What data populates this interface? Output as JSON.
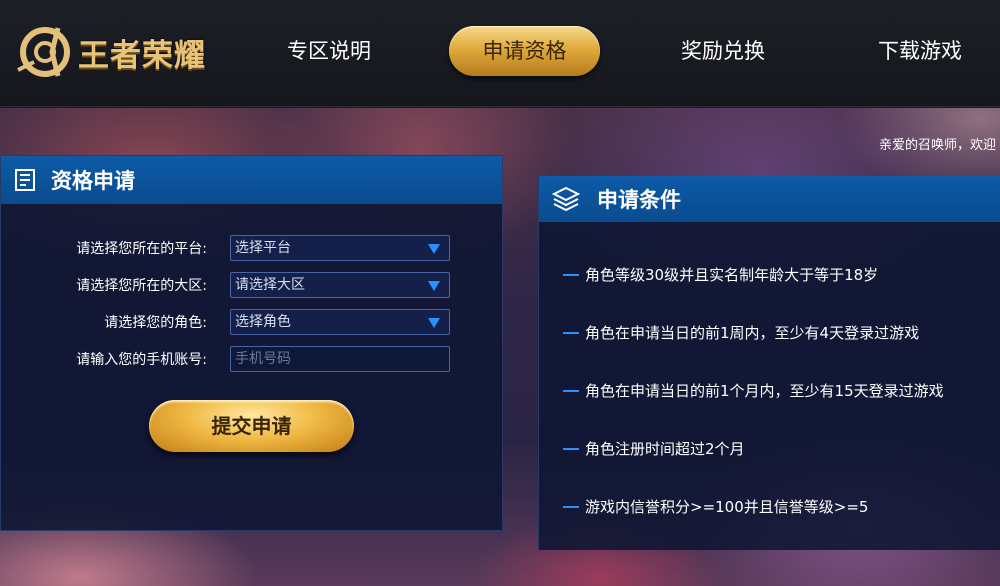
{
  "header": {
    "logo_text": "王者荣耀",
    "nav": [
      {
        "label": "专区说明",
        "active": false
      },
      {
        "label": "申请资格",
        "active": true
      },
      {
        "label": "奖励兑换",
        "active": false
      },
      {
        "label": "下载游戏",
        "active": false
      }
    ]
  },
  "welcome_text": "亲爱的召唤师，欢迎",
  "apply_panel": {
    "title": "资格申请",
    "fields": [
      {
        "label": "请选择您所在的平台:",
        "value": "选择平台",
        "type": "select"
      },
      {
        "label": "请选择您所在的大区:",
        "value": "请选择大区",
        "type": "select"
      },
      {
        "label": "请选择您的角色:",
        "value": "选择角色",
        "type": "select"
      },
      {
        "label": "请输入您的手机账号:",
        "placeholder": "手机号码",
        "type": "input"
      }
    ],
    "submit_label": "提交申请"
  },
  "conditions_panel": {
    "title": "申请条件",
    "items": [
      "角色等级30级并且实名制年龄大于等于18岁",
      "角色在申请当日的前1周内，至少有4天登录过游戏",
      "角色在申请当日的前1个月内，至少有15天登录过游戏",
      "角色注册时间超过2个月",
      "游戏内信誉积分>=100并且信誉等级>=5"
    ]
  },
  "colors": {
    "accent_gold": "#e0aa3c",
    "panel_header_blue": "#0d5aa6",
    "bullet_blue": "#2a8fff"
  }
}
